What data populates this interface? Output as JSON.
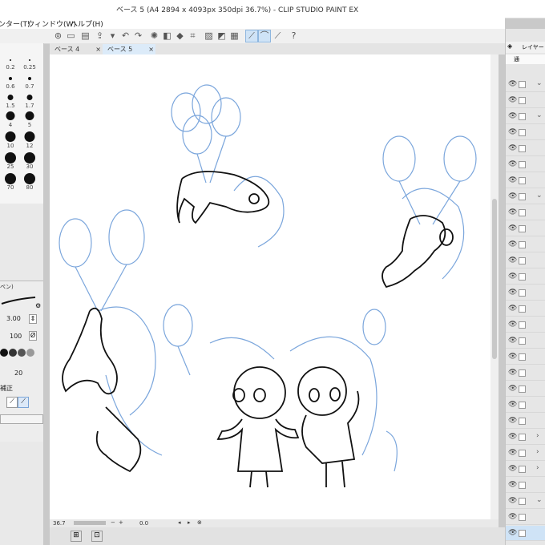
{
  "window": {
    "title": "ベース 5 (A4 2894 x 4093px 350dpi 36.7%) - CLIP STUDIO PAINT EX"
  },
  "menu": {
    "items": [
      "ンター(T)",
      "ウィンドウ(W)",
      "ヘルプ(H)"
    ]
  },
  "tabs": [
    {
      "label": "ベース 4",
      "close": "×"
    },
    {
      "label": "ベース 5",
      "close": "×"
    }
  ],
  "brush_sizes": [
    "0.2",
    "0.25",
    "0.6",
    "0.7",
    "1.5",
    "1.7",
    "4",
    "5",
    "10",
    "12",
    "25",
    "30",
    "70",
    "80"
  ],
  "tool_property": {
    "header": "ぺン)",
    "size": "3.00",
    "opacity": "100",
    "value": "20",
    "correction_label": "補正"
  },
  "status": {
    "zoom": "36.7",
    "angle": "0.0"
  },
  "right_panel": {
    "header": "レイヤー",
    "blend": "通"
  },
  "colors": {
    "sketch_blue": "#7ba6dc",
    "line_black": "#111111",
    "active_tab": "#dcebf9"
  }
}
